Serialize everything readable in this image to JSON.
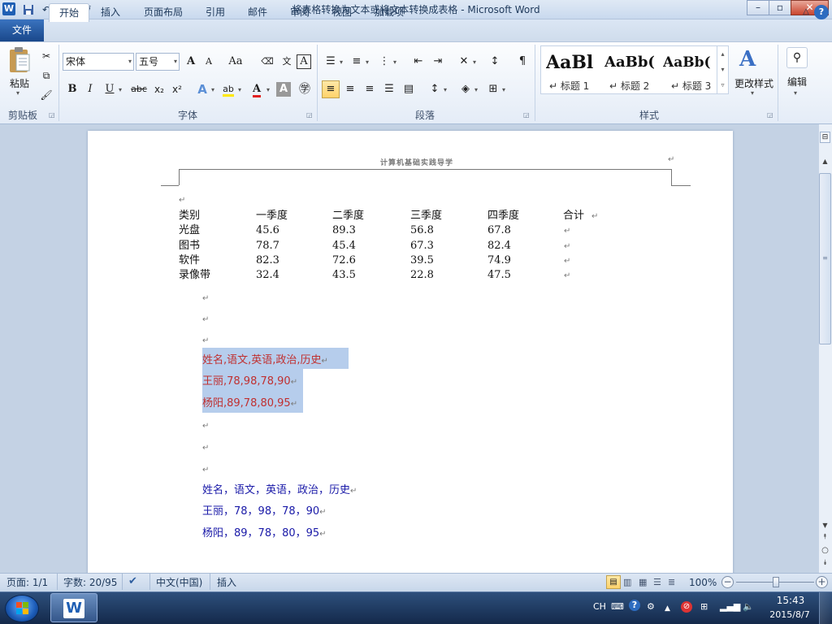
{
  "window": {
    "title": "将表格转换为文本或将文本转换成表格 - Microsoft Word",
    "app_icon": "W",
    "min": "–",
    "max": "▫",
    "close": "✕"
  },
  "tabs": {
    "file": "文件",
    "items": [
      "开始",
      "插入",
      "页面布局",
      "引用",
      "邮件",
      "审阅",
      "视图",
      "加载项"
    ]
  },
  "ribbon": {
    "clipboard": {
      "paste": "粘贴",
      "label": "剪贴板"
    },
    "font": {
      "name": "宋体",
      "size": "五号",
      "grow": "A",
      "shrink": "A",
      "change_case": "Aa",
      "bold": "B",
      "italic": "I",
      "underline": "U",
      "strike": "abc",
      "sub": "x₂",
      "sup": "x²",
      "label": "字体"
    },
    "paragraph": {
      "label": "段落"
    },
    "styles": {
      "samples": [
        "AaBl",
        "AaBb(",
        "AaBb("
      ],
      "names": [
        "↵ 标题 1",
        "↵ 标题 2",
        "↵ 标题 3"
      ],
      "change": "更改样式",
      "label": "样式"
    },
    "editing": {
      "label": "编辑"
    }
  },
  "document": {
    "header": "计算机基础实践导学",
    "table": {
      "headers": [
        "类别",
        "一季度",
        "二季度",
        "三季度",
        "四季度",
        "合计"
      ],
      "rows": [
        [
          "光盘",
          "45.6",
          "89.3",
          "56.8",
          "67.8"
        ],
        [
          "图书",
          "78.7",
          "45.4",
          "67.3",
          "82.4"
        ],
        [
          "软件",
          "82.3",
          "72.6",
          "39.5",
          "74.9"
        ],
        [
          "录像带",
          "32.4",
          "43.5",
          "22.8",
          "47.5"
        ]
      ]
    },
    "selected_lines": [
      "姓名,语文,英语,政治,历史",
      "王丽,78,98,78,90",
      "杨阳,89,78,80,95"
    ],
    "blue_lines": [
      "姓名，语文，英语，政治，历史",
      "王丽，78，98，78，90",
      "杨阳，89，78，80，95"
    ],
    "para_mark": "↵"
  },
  "statusbar": {
    "page": "页面: 1/1",
    "words": "字数: 20/95",
    "language": "中文(中国)",
    "mode": "插入",
    "zoom": "100%"
  },
  "taskbar": {
    "ime": "CH",
    "time": "15:43",
    "date": "2015/8/7"
  },
  "colors": {
    "selection": "#b6cdec",
    "red_text": "#c03030",
    "blue_text": "#1a1aa8"
  }
}
